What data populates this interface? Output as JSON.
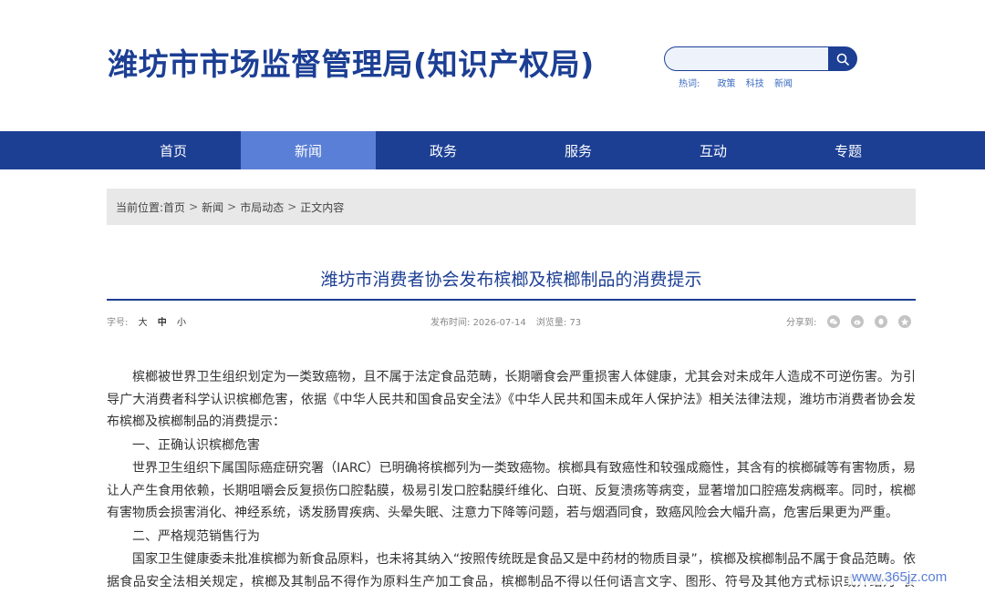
{
  "site": {
    "title": "潍坊市市场监督管理局(知识产权局)"
  },
  "search": {
    "placeholder": "",
    "hot_label": "热词:",
    "hot_words": [
      "政策",
      "科技",
      "新闻"
    ]
  },
  "nav": {
    "items": [
      "首页",
      "新闻",
      "政务",
      "服务",
      "互动",
      "专题"
    ],
    "active": "新闻"
  },
  "breadcrumb": {
    "label": "当前位置:",
    "items": [
      "首页",
      "新闻",
      "市局动态",
      "正文内容"
    ],
    "separator": ">"
  },
  "article": {
    "title": "潍坊市消费者协会发布槟榔及槟榔制品的消费提示",
    "font_size_label": "字号:",
    "font_sizes": [
      "大",
      "中",
      "小"
    ],
    "publish_label": "发布时间:",
    "publish_date": "2026-07-14",
    "views_label": "浏览量:",
    "views": "73",
    "share_label": "分享到:",
    "share_icons": [
      "wechat-icon",
      "weibo-icon",
      "qq-icon",
      "qzone-icon"
    ],
    "paragraphs": [
      "槟榔被世界卫生组织划定为一类致癌物，且不属于法定食品范畴，长期嚼食会严重损害人体健康，尤其会对未成年人造成不可逆伤害。为引导广大消费者科学认识槟榔危害，依据《中华人民共和国食品安全法》《中华人民共和国未成年人保护法》相关法律法规，潍坊市消费者协会发布槟榔及槟榔制品的消费提示：",
      "一、正确认识槟榔危害",
      "世界卫生组织下属国际癌症研究署（IARC）已明确将槟榔列为一类致癌物。槟榔具有致癌性和较强成瘾性，其含有的槟榔碱等有害物质，易让人产生食用依赖，长期咀嚼会反复损伤口腔黏膜，极易引发口腔黏膜纤维化、白斑、反复溃疡等病变，显著增加口腔癌发病概率。同时，槟榔有害物质会损害消化、神经系统，诱发肠胃疾病、头晕失眠、注意力下降等问题，若与烟酒同食，致癌风险会大幅升高，危害后果更为严重。",
      "二、严格规范销售行为",
      "国家卫生健康委未批准槟榔为新食品原料，也未将其纳入“按照传统既是食品又是中药材的物质目录”，槟榔及槟榔制品不属于食品范畴。依据食品安全法相关规定，槟榔及其制品不得作为原料生产加工食品，槟榔制品不得以任何语言文字、图形、符号及其他方式标识或介绍为“食品”或"
    ]
  },
  "watermark": {
    "text": "www.365jz.com"
  },
  "colors": {
    "brand": "#1c3f94",
    "nav_active": "#5a7fd6"
  }
}
